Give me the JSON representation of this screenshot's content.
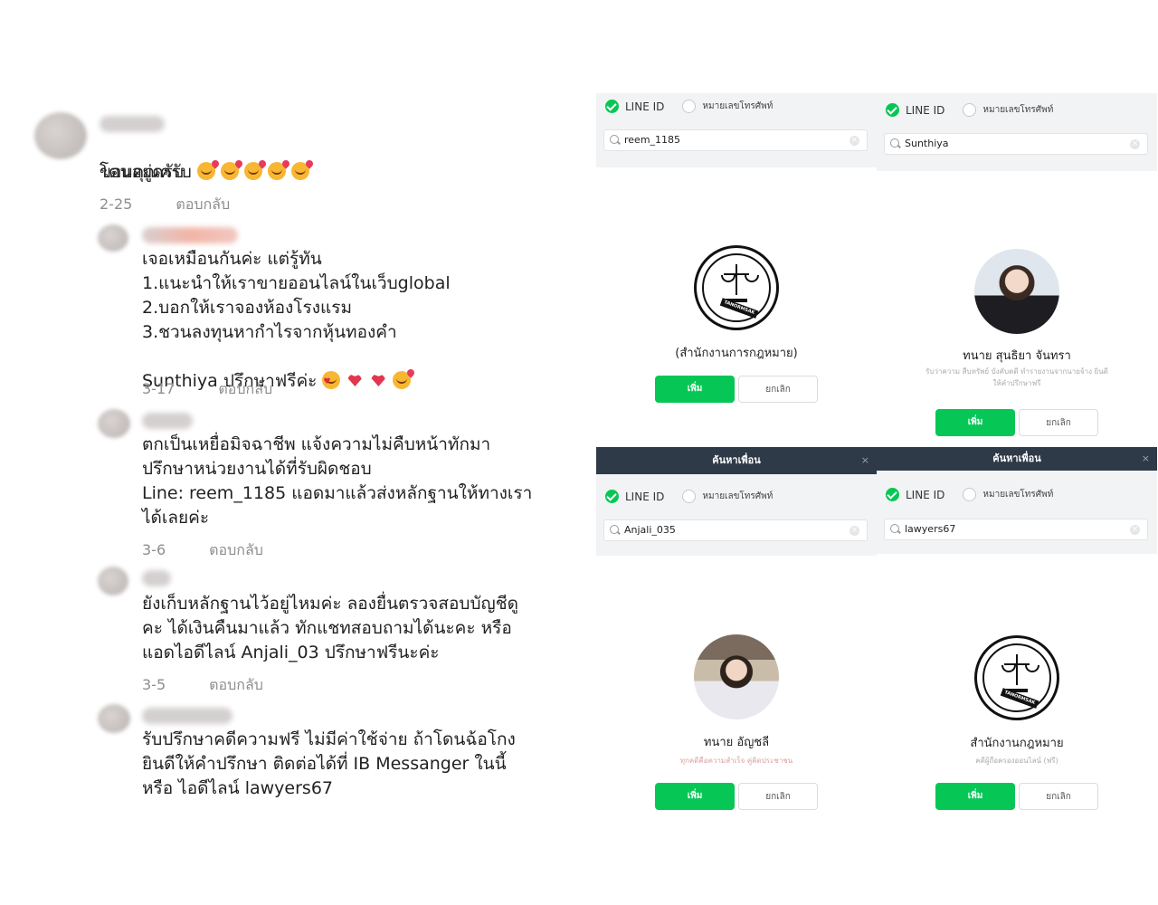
{
  "comments": [
    {
      "lines": [
        "ขอบคุณครับ",
        "โดนอยู่ครับ"
      ],
      "emojis": [
        "kiss-emoji",
        "kiss-emoji",
        "kiss-emoji",
        "kiss-emoji",
        "kiss-emoji"
      ],
      "date": "2-25",
      "reply": "ตอบกลับ"
    },
    {
      "text": "เจอเหมือนกันค่ะ แต่รู้ทัน\n1.แนะนำให้เราขายออนไลน์ในเว็บglobal\n2.บอกให้เราจองห้องโรงแรม\n3.ชวนลงทุนหากำไรจากหุ้นทองคำ",
      "last_line": "Sunthiya ปรึกษาฟรีค่ะ",
      "emojis": [
        "heart-eyes-emoji",
        "heart-emoji",
        "heart-emoji",
        "kiss-emoji"
      ],
      "date": "3-17",
      "reply": "ตอบกลับ"
    },
    {
      "text": "ตกเป็นเหยื่อมิจฉาชีพ แจ้งความไม่คืบหน้าทักมา\nปรึกษาหน่วยงานได้ที่รับผิดชอบ\nLine: reem_1185 แอดมาแล้วส่งหลักฐานให้ทางเรา\nได้เลยค่ะ",
      "date": "3-6",
      "reply": "ตอบกลับ"
    },
    {
      "text": "ยังเก็บหลักฐานไว้อยู่ไหมค่ะ ลองยื่นตรวจสอบบัญชีดู\nคะ ได้เงินคืนมาแล้ว ทักแชทสอบถามได้นะคะ หรือ\nแอดไอดีไลน์ Anjali_03 ปรึกษาฟรีนะค่ะ",
      "date": "3-5",
      "reply": "ตอบกลับ"
    },
    {
      "text": "รับปรึกษาคดีความฟรี ไม่มีค่าใช้จ่าย ถ้าโดนฉ้อโกง\nยินดีให้คำปรึกษา ติดต่อได้ที่ IB Messanger ในนี้\nหรือ ไอดีไลน์ lawyers67"
    }
  ],
  "line_panels": [
    {
      "header": "",
      "radio_line_id": "LINE ID",
      "radio_phone": "หมายเลขโทรศัพท์",
      "search_value": "reem_1185",
      "avatar": "law-office-seal",
      "seal_text": "TANORMSAK",
      "name": "(สำนักงานการกฎหมาย)",
      "desc": "",
      "add": "เพิ่ม",
      "cancel": "ยกเลิก"
    },
    {
      "header": "",
      "radio_line_id": "LINE ID",
      "radio_phone": "หมายเลขโทรศัพท์",
      "search_value": "Sunthiya",
      "avatar": "lawyer-photo",
      "name": "ทนาย สุนธิยา จันทรา",
      "desc": "รับว่าความ สืบทรัพย์ บังคับคดี ทำรายงานจากนายจ้าง ยินดีให้คำปรึกษาฟรี",
      "add": "เพิ่ม",
      "cancel": "ยกเลิก"
    },
    {
      "header": "ค้นหาเพื่อน",
      "radio_line_id": "LINE ID",
      "radio_phone": "หมายเลขโทรศัพท์",
      "search_value": "Anjali_035",
      "avatar": "woman-photo",
      "name": "ทนาย อัญชลี",
      "desc": "ทุกคดีคือความสำเร็จ คู่คิดประชาชน",
      "add": "เพิ่ม",
      "cancel": "ยกเลิก"
    },
    {
      "header": "ค้นหาเพื่อน",
      "radio_line_id": "LINE ID",
      "radio_phone": "หมายเลขโทรศัพท์",
      "search_value": "lawyers67",
      "avatar": "law-office-seal",
      "seal_text": "TANORMSAK",
      "name": "สำนักงานกฎหมาย",
      "desc": "คดีผู้ถือครองออนไลน์ (ฟรี)",
      "add": "เพิ่ม",
      "cancel": "ยกเลิก"
    }
  ],
  "colors": {
    "line_green": "#06c755",
    "panel_header": "#2f3a48",
    "meta_gray": "#8e8e8e"
  }
}
